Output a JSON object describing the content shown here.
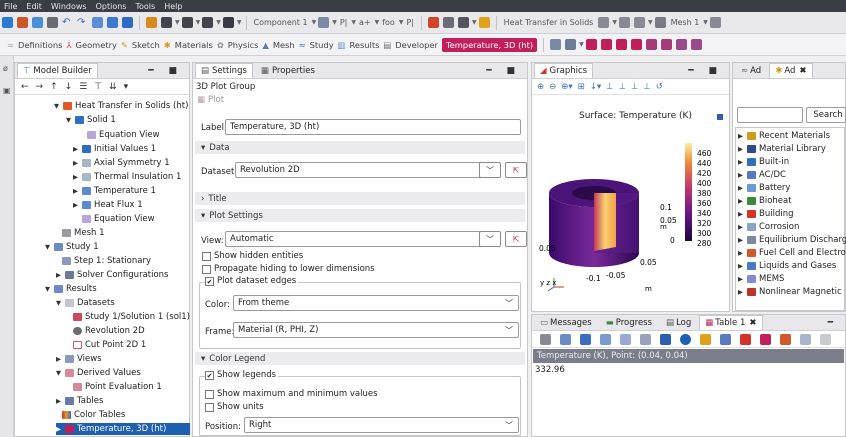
{
  "menu": [
    "File",
    "Edit",
    "Windows",
    "Options",
    "Tools",
    "Help"
  ],
  "ribbon1": {
    "component": "Component 1",
    "pi1": "P|",
    "ai": "a+",
    "foo": "foo",
    "pi2": "P|",
    "physics": "Heat Transfer in Solids",
    "mesh": "Mesh 1"
  },
  "ribbon2": {
    "items": [
      "Definitions",
      "Geometry",
      "Sketch",
      "Materials",
      "Physics",
      "Mesh",
      "Study",
      "Results",
      "Developer"
    ],
    "active_tab": "Temperature, 3D (ht)"
  },
  "model_builder": {
    "title": "Model Builder",
    "items": [
      {
        "label": "Heat Transfer in Solids (ht)",
        "italic_part": "(ht)"
      },
      {
        "label": "Solid 1"
      },
      {
        "label": "Equation View"
      },
      {
        "label": "Initial Values 1"
      },
      {
        "label": "Axial Symmetry 1"
      },
      {
        "label": "Thermal Insulation 1"
      },
      {
        "label": "Temperature 1"
      },
      {
        "label": "Heat Flux 1"
      },
      {
        "label": "Equation View"
      },
      {
        "label": "Mesh 1"
      },
      {
        "label": "Study 1"
      },
      {
        "label": "Step 1: Stationary"
      },
      {
        "label": "Solver Configurations"
      },
      {
        "label": "Results"
      },
      {
        "label": "Datasets"
      },
      {
        "label": "Study 1/Solution 1 (sol1)"
      },
      {
        "label": "Revolution 2D"
      },
      {
        "label": "Cut Point 2D 1"
      },
      {
        "label": "Views"
      },
      {
        "label": "Derived Values"
      },
      {
        "label": "Point Evaluation 1"
      },
      {
        "label": "Tables"
      },
      {
        "label": "Color Tables"
      },
      {
        "label": "Temperature, 3D (ht)"
      }
    ]
  },
  "settings": {
    "tab_settings": "Settings",
    "tab_properties": "Properties",
    "subtitle": "3D Plot Group",
    "plot_button": "Plot",
    "label_caption": "Label:",
    "label_value": "Temperature, 3D (ht)",
    "sec_data": "Data",
    "dataset_caption": "Dataset:",
    "dataset_value": "Revolution 2D",
    "sec_title": "Title",
    "sec_plot_settings": "Plot Settings",
    "view_caption": "View:",
    "view_value": "Automatic",
    "chk_hidden": "Show hidden entities",
    "chk_propagate": "Propagate hiding to lower dimensions",
    "chk_edges": "Plot dataset edges",
    "color_caption": "Color:",
    "color_value": "From theme",
    "frame_caption": "Frame:",
    "frame_value": "Material (R, PHI, Z)",
    "sec_color_legend": "Color Legend",
    "chk_legends": "Show legends",
    "chk_maxmin": "Show maximum and minimum values",
    "chk_units": "Show units",
    "position_caption": "Position:",
    "position_value": "Right"
  },
  "graphics": {
    "tab": "Graphics",
    "plot_title": "Surface: Temperature (K)",
    "colorbar_ticks": [
      "460",
      "440",
      "420",
      "400",
      "380",
      "360",
      "340",
      "320",
      "300",
      "280"
    ],
    "axis_labels": [
      "0.05",
      "0.1",
      "0.05",
      "0",
      "0.05",
      "-0.1",
      "-0.05",
      "0.05",
      "m",
      "m"
    ],
    "axis_triad": "y z x"
  },
  "add_panel": {
    "tab1": "Ad",
    "tab2": "Ad",
    "search_button": "Search",
    "items": [
      "Recent Materials",
      "Material Library",
      "Built-in",
      "AC/DC",
      "Battery",
      "Bioheat",
      "Building",
      "Corrosion",
      "Equilibrium Discharge",
      "Fuel Cell and Electrolyzer",
      "Liquids and Gases",
      "MEMS",
      "Nonlinear Magnetic"
    ]
  },
  "messages": {
    "tabs": [
      "Messages",
      "Progress",
      "Log",
      "Table 1"
    ],
    "table_header": "Temperature (K), Point: (0.04, 0.04)",
    "table_value": "332.96"
  },
  "colors": {
    "accent": "#c21e5a",
    "selection": "#1f5fb3",
    "menubar": "#3a3d45"
  }
}
